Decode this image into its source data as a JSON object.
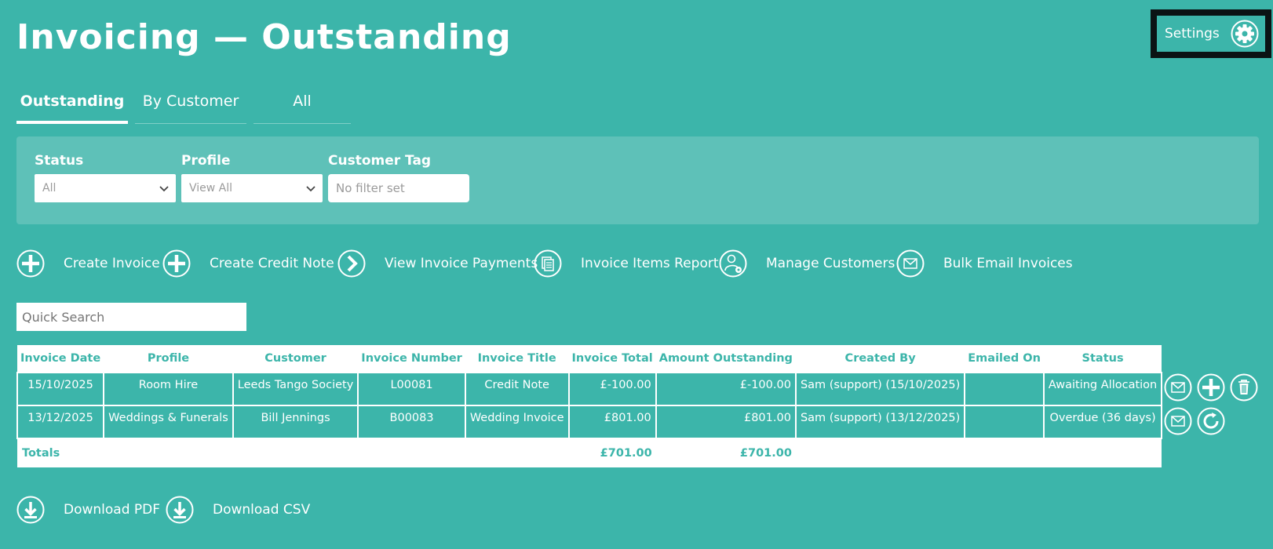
{
  "header": {
    "title": "Invoicing — Outstanding",
    "settings_label": "Settings"
  },
  "tabs": [
    {
      "label": "Outstanding",
      "active": true
    },
    {
      "label": "By Customer",
      "active": false
    },
    {
      "label": "All",
      "active": false
    }
  ],
  "filters": {
    "status": {
      "label": "Status",
      "value": "All"
    },
    "profile": {
      "label": "Profile",
      "value": "View All"
    },
    "customer_tag": {
      "label": "Customer Tag",
      "placeholder": "No filter set"
    }
  },
  "actions": [
    {
      "label": "Create Invoice",
      "icon": "plus-circle-icon"
    },
    {
      "label": "Create Credit Note",
      "icon": "plus-circle-icon"
    },
    {
      "label": "View Invoice Payments",
      "icon": "chevron-right-circle-icon"
    },
    {
      "label": "Invoice Items Report",
      "icon": "documents-icon"
    },
    {
      "label": "Manage Customers",
      "icon": "user-settings-icon"
    },
    {
      "label": "Bulk Email Invoices",
      "icon": "envelope-icon"
    }
  ],
  "search": {
    "placeholder": "Quick Search"
  },
  "table": {
    "columns": [
      "Invoice Date",
      "Profile",
      "Customer",
      "Invoice Number",
      "Invoice Title",
      "Invoice Total",
      "Amount Outstanding",
      "Created By",
      "Emailed On",
      "Status"
    ],
    "rows": [
      [
        "15/10/2025",
        "Room Hire",
        "Leeds Tango Society",
        "L00081",
        "Credit Note",
        "£-100.00",
        "£-100.00",
        "Sam (support) (15/10/2025)",
        "",
        "Awaiting Allocation"
      ],
      [
        "13/12/2025",
        "Weddings & Funerals",
        "Bill Jennings",
        "B00083",
        "Wedding Invoice",
        "£801.00",
        "£801.00",
        "Sam (support) (13/12/2025)",
        "",
        "Overdue (36 days)"
      ]
    ],
    "totals": {
      "label": "Totals",
      "invoice_total": "£701.00",
      "amount_outstanding": "£701.00"
    }
  },
  "row_actions": [
    [
      "envelope-icon",
      "plus-icon",
      "trash-icon"
    ],
    [
      "envelope-icon",
      "refresh-icon"
    ]
  ],
  "downloads": [
    {
      "label": "Download PDF",
      "icon": "download-icon"
    },
    {
      "label": "Download CSV",
      "icon": "download-icon"
    }
  ],
  "colors": {
    "background": "#3cb5aa",
    "panel": "#5ec1b8",
    "text": "#ffffff",
    "settings_border": "#0b1314"
  }
}
